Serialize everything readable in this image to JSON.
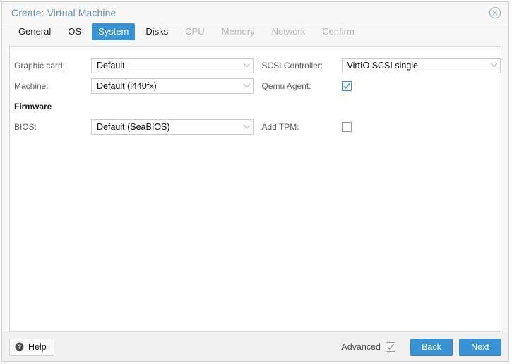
{
  "window": {
    "title": "Create: Virtual Machine",
    "close_icon": "close-circle-icon"
  },
  "tabs": [
    {
      "label": "General",
      "state": "enabled"
    },
    {
      "label": "OS",
      "state": "enabled"
    },
    {
      "label": "System",
      "state": "active"
    },
    {
      "label": "Disks",
      "state": "enabled"
    },
    {
      "label": "CPU",
      "state": "disabled"
    },
    {
      "label": "Memory",
      "state": "disabled"
    },
    {
      "label": "Network",
      "state": "disabled"
    },
    {
      "label": "Confirm",
      "state": "disabled"
    }
  ],
  "form": {
    "left": {
      "graphic_card_label": "Graphic card:",
      "graphic_card_value": "Default",
      "machine_label": "Machine:",
      "machine_value": "Default (i440fx)",
      "firmware_heading": "Firmware",
      "bios_label": "BIOS:",
      "bios_value": "Default (SeaBIOS)"
    },
    "right": {
      "scsi_controller_label": "SCSI Controller:",
      "scsi_controller_value": "VirtIO SCSI single",
      "qemu_agent_label": "Qemu Agent:",
      "qemu_agent_checked": true,
      "add_tpm_label": "Add TPM:",
      "add_tpm_checked": false
    }
  },
  "footer": {
    "help_label": "Help",
    "help_icon": "question-circle-icon",
    "advanced_label": "Advanced",
    "advanced_checked": true,
    "back_label": "Back",
    "next_label": "Next"
  },
  "colors": {
    "accent": "#3892d4",
    "title_text": "#6a93b0",
    "label_text": "#606060",
    "disabled_tab": "#b4b4b4",
    "panel_bg": "#ffffff",
    "window_bg": "#f7f7f7",
    "footer_bg": "#f0f0f0"
  }
}
